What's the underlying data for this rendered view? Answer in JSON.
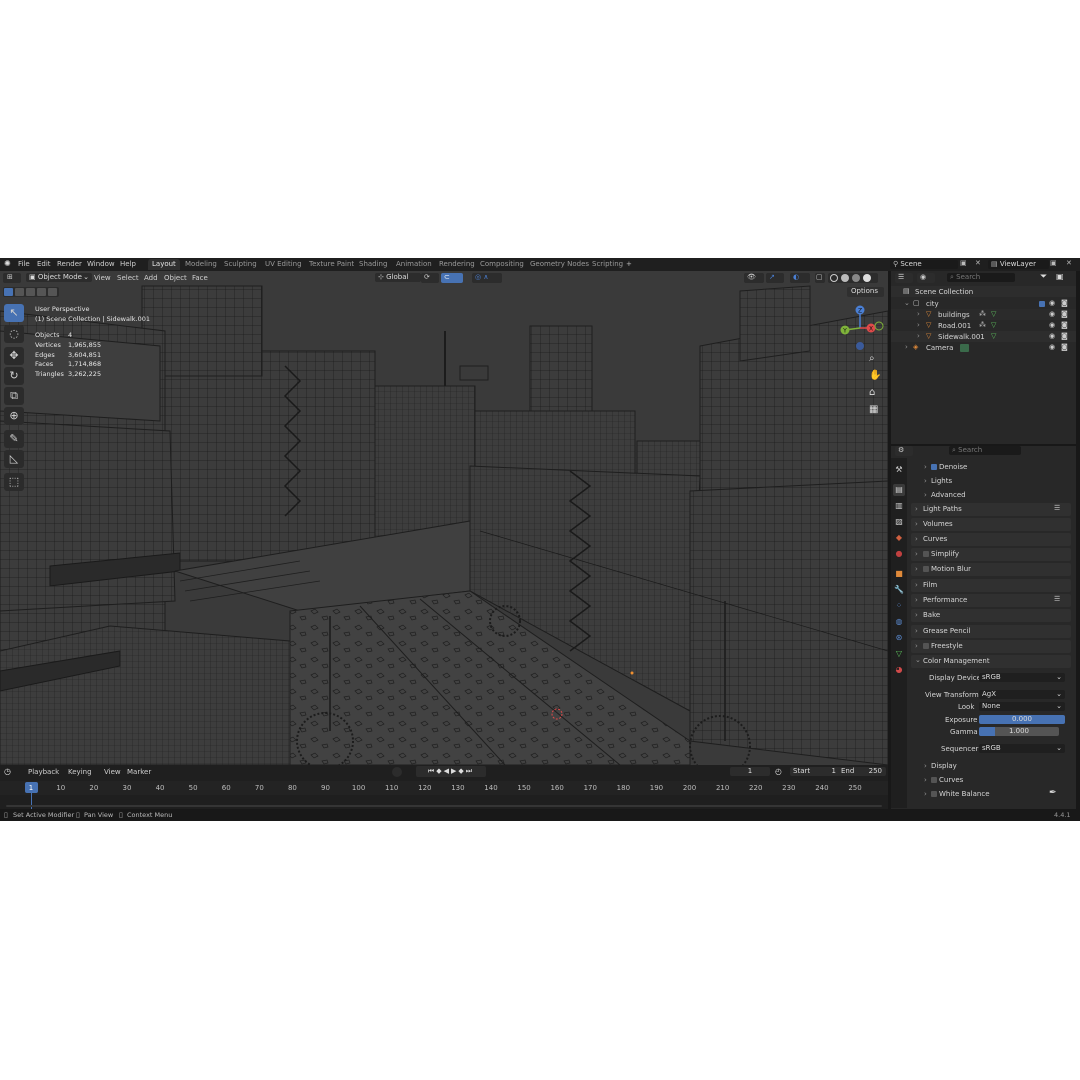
{
  "menu": {
    "items": [
      "File",
      "Edit",
      "Render",
      "Window",
      "Help"
    ],
    "workspaces": [
      "Layout",
      "Modeling",
      "Sculpting",
      "UV Editing",
      "Texture Paint",
      "Shading",
      "Animation",
      "Rendering",
      "Compositing",
      "Geometry Nodes",
      "Scripting"
    ],
    "active_workspace": "Layout",
    "add_tab": "+",
    "scene_label": "Scene",
    "viewlayer_label": "ViewLayer"
  },
  "viewport_header": {
    "mode": "Object Mode",
    "menus": [
      "View",
      "Select",
      "Add",
      "Object",
      "Face"
    ],
    "transform_orientation": "Global",
    "options_label": "Options"
  },
  "overlay": {
    "perspective": "User Perspective",
    "collection": "(1) Scene Collection | Sidewalk.001",
    "stats": [
      {
        "label": "Objects",
        "value": "4"
      },
      {
        "label": "Vertices",
        "value": "1,965,855"
      },
      {
        "label": "Edges",
        "value": "3,604,851"
      },
      {
        "label": "Faces",
        "value": "1,714,868"
      },
      {
        "label": "Triangles",
        "value": "3,262,225"
      }
    ]
  },
  "gizmo": {
    "x": "X",
    "y": "Y",
    "z": "Z"
  },
  "timeline": {
    "menus": [
      "Playback",
      "Keying",
      "View",
      "Marker"
    ],
    "current_frame": "1",
    "start_label": "Start",
    "start_value": "1",
    "end_label": "End",
    "end_value": "250",
    "ticks": [
      "1",
      "10",
      "20",
      "30",
      "40",
      "50",
      "60",
      "70",
      "80",
      "90",
      "100",
      "110",
      "120",
      "130",
      "140",
      "150",
      "160",
      "170",
      "180",
      "190",
      "200",
      "210",
      "220",
      "230",
      "240",
      "250"
    ]
  },
  "outliner": {
    "search_placeholder": "Search",
    "root": "Scene Collection",
    "collection": "city",
    "objects": [
      "buildings",
      "Road.001",
      "Sidewalk.001"
    ],
    "camera": "Camera"
  },
  "properties": {
    "search_placeholder": "Search",
    "sub_panels": [
      "Denoise",
      "Lights",
      "Advanced"
    ],
    "panels": [
      "Light Paths",
      "Volumes",
      "Curves",
      "Simplify",
      "Motion Blur",
      "Film",
      "Performance",
      "Bake",
      "Grease Pencil",
      "Freestyle",
      "Color Management"
    ],
    "color_management": {
      "display_device_label": "Display Device",
      "display_device": "sRGB",
      "view_transform_label": "View Transform",
      "view_transform": "AgX",
      "look_label": "Look",
      "look": "None",
      "exposure_label": "Exposure",
      "exposure": "0.000",
      "gamma_label": "Gamma",
      "gamma": "1.000",
      "sequencer_label": "Sequencer",
      "sequencer": "sRGB"
    },
    "cm_sub_panels": [
      "Display",
      "Curves",
      "White Balance"
    ]
  },
  "status": {
    "hints": [
      "Set Active Modifier",
      "Pan View",
      "Context Menu"
    ],
    "version": "4.4.1"
  },
  "colors": {
    "accent": "#4772b3",
    "viewport_bg": "#3c3c3c",
    "panel_bg": "#282828",
    "axis_x": "#e04a4a",
    "axis_y": "#7fb33a",
    "axis_z": "#4a7fd4"
  },
  "icons": [
    "blender-logo-icon",
    "select-box-icon",
    "cursor-icon",
    "move-icon",
    "rotate-icon",
    "scale-icon",
    "transform-icon",
    "annotate-icon",
    "measure-icon",
    "add-cube-icon",
    "zoom-icon",
    "hand-icon",
    "camera-view-icon",
    "grid-icon",
    "eye-icon",
    "camera-icon",
    "filter-icon",
    "play-icon"
  ]
}
